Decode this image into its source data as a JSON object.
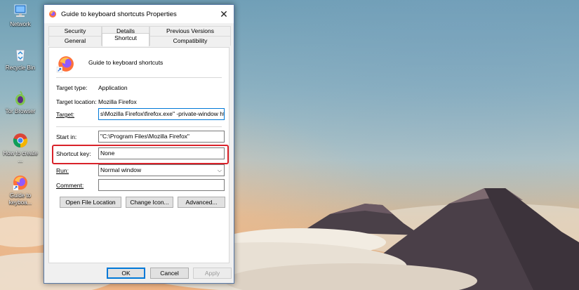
{
  "desktop": {
    "icons": [
      {
        "label": "Network",
        "icon": "network-icon"
      },
      {
        "label": "Recycle Bin",
        "icon": "recycle-bin-icon"
      },
      {
        "label": "Tor Browser",
        "icon": "tor-browser-icon"
      },
      {
        "label": "How to create ...",
        "icon": "chrome-icon"
      },
      {
        "label": "Guide to keyboa...",
        "icon": "firefox-shortcut-icon"
      }
    ]
  },
  "dialog": {
    "title": "Guide to keyboard shortcuts Properties",
    "tabs_row1": [
      "Security",
      "Details",
      "Previous Versions"
    ],
    "tabs_row2": [
      "General",
      "Shortcut",
      "Compatibility"
    ],
    "selected_tab": "Shortcut",
    "shortcut_name": "Guide to keyboard shortcuts",
    "target_type_label": "Target type:",
    "target_type_value": "Application",
    "target_location_label": "Target location:",
    "target_location_value": "Mozilla Firefox",
    "target_label": "Target:",
    "target_value": "s\\Mozilla Firefox\\firefox.exe\" -private-window https",
    "start_in_label": "Start in:",
    "start_in_value": "\"C:\\Program Files\\Mozilla Firefox\"",
    "shortcut_key_label": "Shortcut key:",
    "shortcut_key_value": "None",
    "run_label": "Run:",
    "run_value": "Normal window",
    "comment_label": "Comment:",
    "comment_value": "",
    "buttons": {
      "open_file_location": "Open File Location",
      "change_icon": "Change Icon...",
      "advanced": "Advanced..."
    },
    "footer": {
      "ok": "OK",
      "cancel": "Cancel",
      "apply": "Apply"
    }
  },
  "colors": {
    "highlight_border": "#d9222a",
    "focus_border": "#0078d7"
  }
}
